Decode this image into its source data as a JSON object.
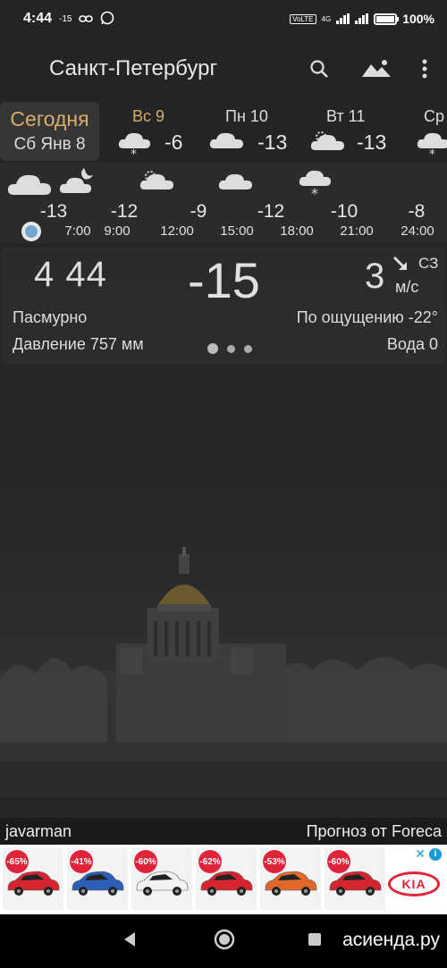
{
  "status_bar": {
    "time": "4:44",
    "temp": "-15",
    "battery": "100%",
    "net_label": "4G",
    "volte_label": "VoLTE"
  },
  "app_bar": {
    "city": "Санкт-Петербург",
    "icons": [
      "search-icon",
      "landscape-icon",
      "more-vert-icon"
    ]
  },
  "days": [
    {
      "name": "Сегодня",
      "date": "Сб Янв 8"
    },
    {
      "name": "Вс 9",
      "temp": "-6",
      "icon": "snow-cloud-icon"
    },
    {
      "name": "Пн 10",
      "temp": "-13",
      "icon": "cloud-icon"
    },
    {
      "name": "Вт 11",
      "temp": "-13",
      "icon": "partly-cloudy-icon"
    },
    {
      "name": "Ср",
      "icon": "snow-cloud-icon"
    }
  ],
  "hourly": [
    {
      "time": "",
      "temp": "-13",
      "icon": "cloud-icon"
    },
    {
      "time": "7:00",
      "temp": "",
      "icon": "night-cloud-icon"
    },
    {
      "time": "9:00",
      "temp": "-12",
      "icon": "partly-cloudy-icon"
    },
    {
      "time": "12:00",
      "temp": "-9",
      "icon": "partly-cloudy-icon"
    },
    {
      "time": "15:00",
      "temp": "-12",
      "icon": "cloud-icon"
    },
    {
      "time": "18:00",
      "temp": "-10",
      "icon": "snow-cloud-icon"
    },
    {
      "time": "21:00",
      "temp": "-8",
      "icon": ""
    },
    {
      "time": "24:00",
      "temp": "",
      "icon": ""
    }
  ],
  "current": {
    "time": "4 44",
    "temp": "-15",
    "wind_speed": "3",
    "wind_dir": "СЗ",
    "wind_unit": "м/с",
    "condition": "Пасмурно",
    "feels_like": "По ощущению -22°",
    "pressure": "Давление 757 мм",
    "water": "Вода 0"
  },
  "credits": {
    "user": "javarman",
    "source": "Прогноз от Foreca"
  },
  "ad": {
    "discounts": [
      "-65%",
      "-41%",
      "-60%",
      "-62%",
      "-53%",
      "-60%"
    ],
    "brand": "KIA",
    "car_colors": [
      "#d6252f",
      "#2b5fb8",
      "#f2f2f2",
      "#d6252f",
      "#e0682a",
      "#d6252f"
    ]
  },
  "watermark": "асиенда.ру",
  "colors": {
    "accent_gold": "#d8ad6a",
    "now_dot": "#6fa7cf",
    "ad_red": "#e0243a"
  }
}
